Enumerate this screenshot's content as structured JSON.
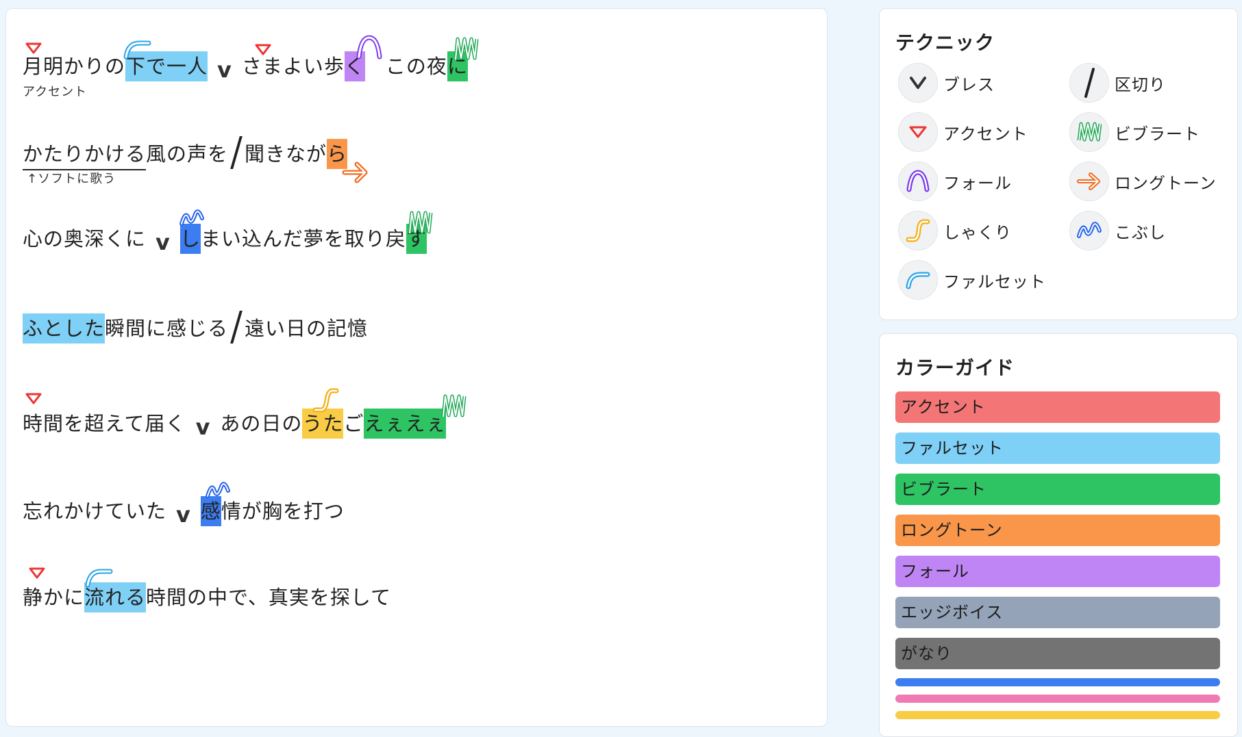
{
  "lyrics": {
    "line1": {
      "a": "月明かりの",
      "b": "下で一人",
      "c": "さまよい歩",
      "d": "く",
      "e": "この夜",
      "f": "に"
    },
    "line1_note": "アクセント",
    "line2": {
      "a": "かたりかける",
      "b": "風の声を",
      "c": "聞きなが",
      "d": "ら"
    },
    "line2_note": "↑ソフトに歌う",
    "line3": {
      "a": "心の奥深くに",
      "b": "し",
      "c": "まい込んだ夢を取り戻",
      "d": "す"
    },
    "line4": {
      "a": "ふとした",
      "b": "瞬間に感じる",
      "c": "遠い日の記憶"
    },
    "line5": {
      "a": "時間を超えて届く",
      "b": "あの日の",
      "c": "うた",
      "d": "ご",
      "e": "えぇえぇ"
    },
    "line6": {
      "a": "忘れかけていた",
      "b": "感",
      "c": "情が胸を打つ"
    },
    "line7": {
      "a": "静かに",
      "b": "流れる",
      "c": "時間の中で、真実を探して"
    },
    "breath_symbol": "v"
  },
  "techniques": {
    "title": "テクニック",
    "items": [
      {
        "label": "ブレス",
        "icon": "breath-icon"
      },
      {
        "label": "区切り",
        "icon": "slash-icon"
      },
      {
        "label": "アクセント",
        "icon": "accent-icon"
      },
      {
        "label": "ビブラート",
        "icon": "vibrato-icon"
      },
      {
        "label": "フォール",
        "icon": "fall-icon"
      },
      {
        "label": "ロングトーン",
        "icon": "arrow-right-icon"
      },
      {
        "label": "しゃくり",
        "icon": "shakuri-icon"
      },
      {
        "label": "こぶし",
        "icon": "kobushi-icon"
      },
      {
        "label": "ファルセット",
        "icon": "falsetto-icon"
      }
    ]
  },
  "color_guide": {
    "title": "カラーガイド",
    "items": [
      {
        "label": "アクセント",
        "color": "#f47575"
      },
      {
        "label": "ファルセット",
        "color": "#7fd0f6"
      },
      {
        "label": "ビブラート",
        "color": "#2ec464"
      },
      {
        "label": "ロングトーン",
        "color": "#f9964a"
      },
      {
        "label": "フォール",
        "color": "#bf85f5"
      },
      {
        "label": "エッジボイス",
        "color": "#94a3b8"
      },
      {
        "label": "がなり",
        "color": "#737373"
      }
    ],
    "extra_colors": [
      "#3c7df1",
      "#f07ab2",
      "#f8cc45"
    ]
  }
}
